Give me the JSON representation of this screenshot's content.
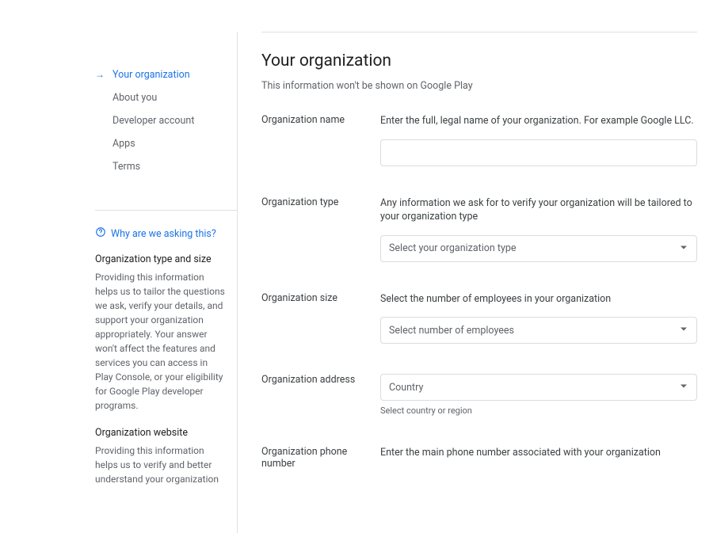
{
  "sidebar": {
    "nav": [
      {
        "label": "Your organization",
        "active": true
      },
      {
        "label": "About you",
        "active": false
      },
      {
        "label": "Developer account",
        "active": false
      },
      {
        "label": "Apps",
        "active": false
      },
      {
        "label": "Terms",
        "active": false
      }
    ],
    "help": {
      "header": "Why are we asking this?",
      "blocks": [
        {
          "title": "Organization type and size",
          "text": "Providing this information helps us to tailor the questions we ask, verify your details, and support your organization appropriately. Your answer won't affect the features and services you can access in Play Console, or your eligibility for Google Play developer programs."
        },
        {
          "title": "Organization website",
          "text": "Providing this information helps us to verify and better understand your organization"
        }
      ]
    }
  },
  "main": {
    "title": "Your organization",
    "subtitle": "This information won't be shown on Google Play",
    "fields": {
      "org_name": {
        "label": "Organization name",
        "help": "Enter the full, legal name of your organization. For example Google LLC.",
        "value": ""
      },
      "org_type": {
        "label": "Organization type",
        "help": "Any information we ask for to verify your organization will be tailored to your organization type",
        "placeholder": "Select your organization type"
      },
      "org_size": {
        "label": "Organization size",
        "help": "Select the number of employees in your organization",
        "placeholder": "Select number of employees"
      },
      "org_address": {
        "label": "Organization address",
        "placeholder": "Country",
        "sub_help": "Select country or region"
      },
      "org_phone": {
        "label": "Organization phone number",
        "help": "Enter the main phone number associated with your organization"
      }
    }
  }
}
